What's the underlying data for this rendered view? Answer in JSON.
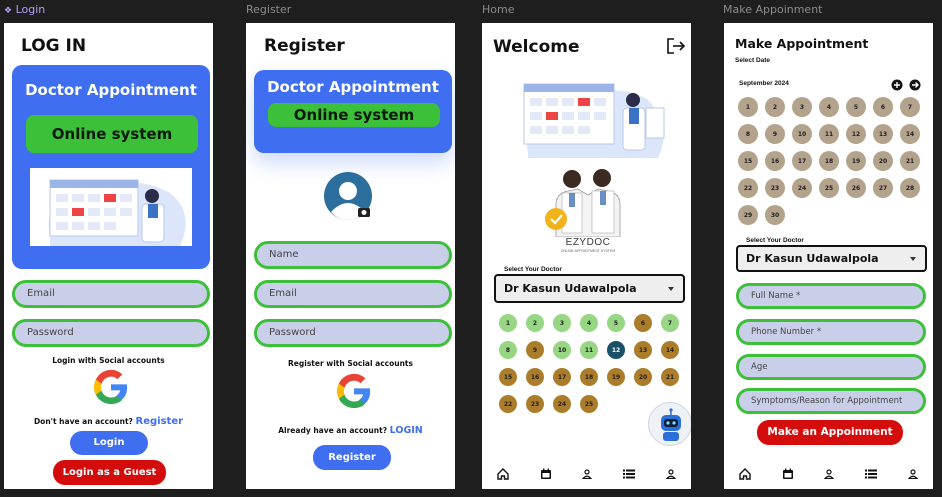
{
  "frames": {
    "login_label": "Login",
    "register_label": "Register",
    "home_label": "Home",
    "appointment_label": "Make Appoinment"
  },
  "login": {
    "title": "LOG IN",
    "hero_title": "Doctor Appointment",
    "hero_subtitle": "Online system",
    "email_placeholder": "Email",
    "password_placeholder": "Password",
    "social_text": "Login with Social accounts",
    "no_account_text": "Don't have an account?",
    "register_link": "Register",
    "login_button": "Login",
    "guest_button": "Login as a Guest"
  },
  "register": {
    "title": "Register",
    "hero_title": "Doctor Appointment",
    "hero_subtitle": "Online system",
    "name_placeholder": "Name",
    "email_placeholder": "Email",
    "password_placeholder": "Password",
    "social_text": "Register with Social accounts",
    "have_account_text": "Already have an account?",
    "login_link": "LOGIN",
    "register_button": "Register"
  },
  "home": {
    "title": "Welcome",
    "logo_name": "EZYDOC",
    "logo_tagline": "ONLINE APPOINTMENT SYSTEM",
    "select_doctor_label": "Select Your Doctor",
    "selected_doctor": "Dr Kasun Udawalpola",
    "dates": [
      {
        "day": "1",
        "status": "available"
      },
      {
        "day": "2",
        "status": "available"
      },
      {
        "day": "3",
        "status": "available"
      },
      {
        "day": "4",
        "status": "available"
      },
      {
        "day": "5",
        "status": "available"
      },
      {
        "day": "6",
        "status": "booked"
      },
      {
        "day": "7",
        "status": "available"
      },
      {
        "day": "8",
        "status": "available"
      },
      {
        "day": "9",
        "status": "booked"
      },
      {
        "day": "10",
        "status": "available"
      },
      {
        "day": "11",
        "status": "available"
      },
      {
        "day": "12",
        "status": "selected"
      },
      {
        "day": "13",
        "status": "booked"
      },
      {
        "day": "14",
        "status": "booked"
      },
      {
        "day": "15",
        "status": "booked"
      },
      {
        "day": "16",
        "status": "booked"
      },
      {
        "day": "17",
        "status": "booked"
      },
      {
        "day": "18",
        "status": "booked"
      },
      {
        "day": "19",
        "status": "booked"
      },
      {
        "day": "20",
        "status": "booked"
      },
      {
        "day": "21",
        "status": "booked"
      },
      {
        "day": "22",
        "status": "booked"
      },
      {
        "day": "23",
        "status": "booked"
      },
      {
        "day": "24",
        "status": "booked"
      },
      {
        "day": "25",
        "status": "booked"
      }
    ]
  },
  "appointment": {
    "title": "Make Appointment",
    "select_date_label": "Select Date",
    "month": "September 2024",
    "days": [
      "1",
      "2",
      "3",
      "4",
      "5",
      "6",
      "7",
      "8",
      "9",
      "10",
      "11",
      "12",
      "13",
      "14",
      "15",
      "16",
      "17",
      "18",
      "19",
      "20",
      "21",
      "22",
      "23",
      "24",
      "25",
      "26",
      "27",
      "28",
      "29",
      "30"
    ],
    "select_doctor_label": "Select Your Doctor",
    "selected_doctor": "Dr Kasun Udawalpola",
    "fullname_placeholder": "Full Name *",
    "phone_placeholder": "Phone Number *",
    "age_placeholder": "Age",
    "symptoms_placeholder": "Symptoms/Reason for Appointment",
    "submit_button": "Make an Appoinment"
  },
  "colors": {
    "brand_blue": "#3f6ef0",
    "green_border": "#3cbf39",
    "input_fill": "#c9cfe8",
    "red": "#d40c0c",
    "available": "#97d683",
    "booked": "#ab7d2b",
    "selected": "#1b5168",
    "calendar_day": "#b3a38d"
  },
  "icons": {
    "frame": "diamond-component-icon",
    "google": "google-g-icon",
    "avatar": "user-avatar-camera-icon",
    "logout": "logout-icon",
    "nav": [
      "home-icon",
      "calendar-icon",
      "profile-icon",
      "list-icon",
      "person-icon"
    ],
    "chatbot": "robot-chatbot-icon"
  }
}
